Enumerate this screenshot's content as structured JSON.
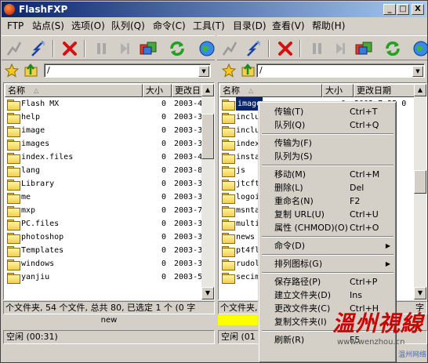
{
  "window": {
    "title": "FlashFXP",
    "min": "_",
    "max": "□",
    "close": "X"
  },
  "menu": [
    "FTP",
    "站点(S)",
    "选项(O)",
    "队列(Q)",
    "命令(C)",
    "工具(T)",
    "目录(D)",
    "查看(V)",
    "帮助(H)"
  ],
  "left": {
    "path": "/",
    "columns": {
      "name": "名称",
      "size": "大小",
      "date": "更改日"
    },
    "rows": [
      {
        "name": "Flash MX",
        "size": "0",
        "date": "2003-4"
      },
      {
        "name": "help",
        "size": "0",
        "date": "2003-3"
      },
      {
        "name": "image",
        "size": "0",
        "date": "2003-3"
      },
      {
        "name": "images",
        "size": "0",
        "date": "2003-3"
      },
      {
        "name": "index.files",
        "size": "0",
        "date": "2003-4"
      },
      {
        "name": "lang",
        "size": "0",
        "date": "2003-8"
      },
      {
        "name": "Library",
        "size": "0",
        "date": "2003-3"
      },
      {
        "name": "me",
        "size": "0",
        "date": "2003-3"
      },
      {
        "name": "mxp",
        "size": "0",
        "date": "2003-7"
      },
      {
        "name": "PC.files",
        "size": "0",
        "date": "2003-3"
      },
      {
        "name": "photoshop",
        "size": "0",
        "date": "2003-3"
      },
      {
        "name": "Templates",
        "size": "0",
        "date": "2003-3"
      },
      {
        "name": "windows",
        "size": "0",
        "date": "2003-3"
      },
      {
        "name": "yanjiu",
        "size": "0",
        "date": "2003-5"
      }
    ],
    "status": "个文件夹, 54 个文件, 总共 80, 已选定 1 个 (0 字",
    "queue_label": "new",
    "footer": "空闲  (00:31)"
  },
  "right": {
    "path": "/",
    "columns": {
      "name": "名称",
      "size": "大小",
      "date": "更改日期"
    },
    "rows": [
      {
        "name": "image",
        "size": "0",
        "date": "2003-7-25 0"
      },
      {
        "name": "inclu",
        "size": "",
        "date": "1"
      },
      {
        "name": "inclu",
        "size": "",
        "date": "18"
      },
      {
        "name": "index",
        "size": "",
        "date": "10"
      },
      {
        "name": "insta",
        "size": "",
        "date": "16"
      },
      {
        "name": "js",
        "size": "",
        "date": "23"
      },
      {
        "name": "jtcft",
        "size": "",
        "date": "12"
      },
      {
        "name": "logoi",
        "size": "",
        "date": "13"
      },
      {
        "name": "msnta",
        "size": "",
        "date": "13"
      },
      {
        "name": "multi",
        "size": "",
        "date": "13"
      },
      {
        "name": "news",
        "size": "",
        "date": "13"
      },
      {
        "name": "pt4fl",
        "size": "",
        "date": "15"
      },
      {
        "name": "rudol",
        "size": "",
        "date": "13"
      },
      {
        "name": "secim",
        "size": "",
        "date": "16"
      }
    ],
    "status": "个文件夹, 80",
    "status_tail": "字",
    "footer": "空闲  (01"
  },
  "context_menu": [
    {
      "label": "传输(T)",
      "shortcut": "Ctrl+T"
    },
    {
      "label": "队列(Q)",
      "shortcut": "Ctrl+Q"
    },
    {
      "sep": true
    },
    {
      "label": "传输为(F)",
      "shortcut": ""
    },
    {
      "label": "队列为(S)",
      "shortcut": ""
    },
    {
      "sep": true
    },
    {
      "label": "移动(M)",
      "shortcut": "Ctrl+M"
    },
    {
      "label": "删除(L)",
      "shortcut": "Del"
    },
    {
      "label": "重命名(N)",
      "shortcut": "F2"
    },
    {
      "label": "复制 URL(U)",
      "shortcut": "Ctrl+U"
    },
    {
      "label": "属性 (CHMOD)(O)",
      "shortcut": "Ctrl+O"
    },
    {
      "sep": true
    },
    {
      "label": "命令(D)",
      "shortcut": "",
      "submenu": true
    },
    {
      "sep": true
    },
    {
      "label": "排列图标(G)",
      "shortcut": "",
      "submenu": true
    },
    {
      "sep": true
    },
    {
      "label": "保存路径(P)",
      "shortcut": "Ctrl+P"
    },
    {
      "label": "建立文件夹(D)",
      "shortcut": "Ins"
    },
    {
      "label": "更改文件夹(C)",
      "shortcut": "Ctrl+H"
    },
    {
      "label": "复制文件夹(I)",
      "shortcut": ""
    },
    {
      "sep": true
    },
    {
      "label": "刷新(R)",
      "shortcut": "F5"
    }
  ],
  "watermark": {
    "text": "溫州視線",
    "url": "www.wenzhou.cn",
    "sub": "温州网络"
  },
  "colors": {
    "title_start": "#0a246a",
    "title_end": "#a6caf0",
    "selection": "#0a246a",
    "queue_bar": "#ffff00",
    "face": "#d4d0c8"
  }
}
